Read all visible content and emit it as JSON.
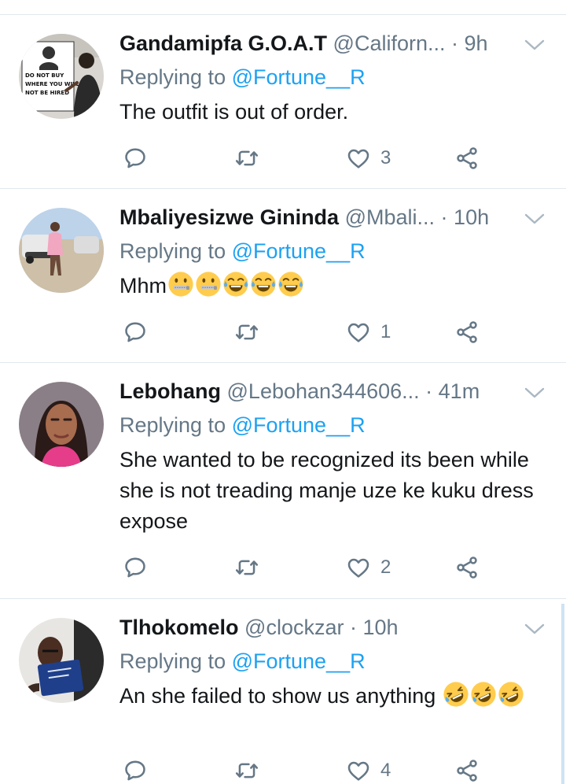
{
  "tweets": [
    {
      "display_name": "Gandamipfa G.O.A.T",
      "handle": "@Californ...",
      "dot": " · ",
      "time": "9h",
      "replying_prefix": "Replying to ",
      "replying_to": "@Fortune__R",
      "text": "The outfit is out of order.",
      "emojis": [],
      "reply_count": "",
      "retweet_count": "",
      "like_count": "3",
      "avatar_sign": [
        "DO NOT BUY",
        "WHERE YOU WILL",
        "NOT BE HIRED"
      ]
    },
    {
      "display_name": "Mbaliyesizwe Gininda",
      "handle": "@Mbali...",
      "dot": " · ",
      "time": "10h",
      "replying_prefix": "Replying to ",
      "replying_to": "@Fortune__R",
      "text": "Mhm",
      "emojis": [
        "zipper-mouth-face",
        "zipper-mouth-face",
        "face-with-tears-of-joy",
        "face-with-tears-of-joy",
        "face-with-tears-of-joy"
      ],
      "reply_count": "",
      "retweet_count": "",
      "like_count": "1"
    },
    {
      "display_name": "Lebohang",
      "handle": "@Lebohan344606...",
      "dot": " · ",
      "time": "41m",
      "replying_prefix": "Replying to ",
      "replying_to": "@Fortune__R",
      "text": "She wanted to be recognized its been while she is not treading manje uze ke kuku dress expose",
      "emojis": [],
      "reply_count": "",
      "retweet_count": "",
      "like_count": "2"
    },
    {
      "display_name": "Tlhokomelo",
      "handle": "@clockzar",
      "dot": " · ",
      "time": "10h",
      "replying_prefix": "Replying to ",
      "replying_to": "@Fortune__R",
      "text": "An she failed to show us anything",
      "emojis": [
        "rolling-on-the-floor-laughing",
        "rolling-on-the-floor-laughing",
        "rolling-on-the-floor-laughing"
      ],
      "reply_count": "",
      "retweet_count": "",
      "like_count": "4"
    }
  ],
  "colors": {
    "text": "#14171a",
    "muted": "#657786",
    "link": "#1da1f2",
    "divider": "#e1e8ed",
    "thread_line": "#cfe3f3"
  },
  "icons": {
    "reply": "speech-bubble-icon",
    "retweet": "retweet-icon",
    "like": "heart-icon",
    "share": "share-icon",
    "menu": "chevron-down-icon"
  }
}
